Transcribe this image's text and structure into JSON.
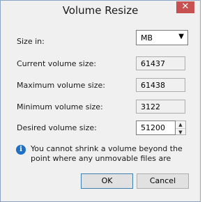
{
  "window": {
    "title": "Volume Resize",
    "close_glyph": "✕"
  },
  "size_in": {
    "label": "Size in:",
    "selected": "MB"
  },
  "current": {
    "label": "Current volume size:",
    "value": "61437"
  },
  "maximum": {
    "label": "Maximum volume size:",
    "value": "61438"
  },
  "minimum": {
    "label": "Minimum volume size:",
    "value": "3122"
  },
  "desired": {
    "label": "Desired volume size:",
    "value": "51200"
  },
  "info": {
    "icon": "info-icon",
    "text": "You cannot shrink a volume beyond the point where any unmovable files are"
  },
  "buttons": {
    "ok": "OK",
    "cancel": "Cancel"
  }
}
